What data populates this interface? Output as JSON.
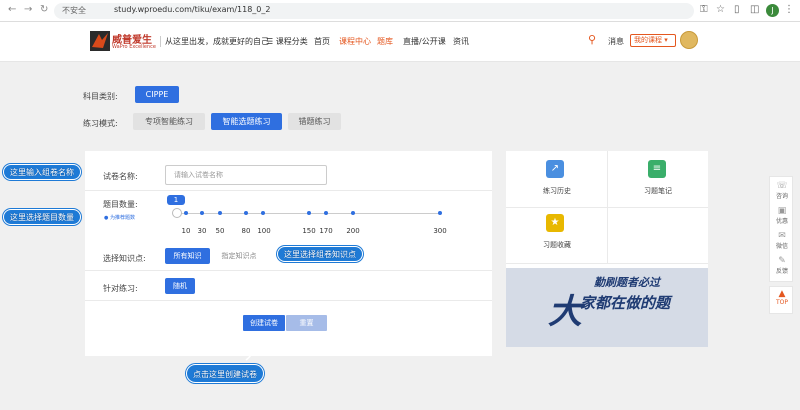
{
  "browser": {
    "security_label": "不安全",
    "url": "study.wproedu.com/tiku/exam/118_0_2",
    "profile_initial": "J"
  },
  "header": {
    "logo_cn": "威普爱生",
    "logo_en": "WaPro Excellence",
    "slogan": "从这里出发，成就更好的自己",
    "menu": [
      "课程分类",
      "首页",
      "课程中心",
      "题库",
      "直播/公开课",
      "资讯"
    ],
    "active_menu": "课程中心",
    "messages": "消息",
    "my_courses": "我的课程"
  },
  "filters": {
    "subject_label": "科目类别:",
    "subject_value": "CIPPE",
    "mode_label": "练习模式:",
    "modes": [
      "专项智能练习",
      "智能选题练习",
      "错题练习"
    ],
    "active_mode": "智能选题练习"
  },
  "form": {
    "paper_name_label": "试卷名称:",
    "paper_name_placeholder": "请输入试卷名称",
    "count_label": "题目数量:",
    "count_value": "1",
    "recommend_text": "为推荐题数",
    "ticks": [
      "10",
      "30",
      "50",
      "80",
      "100",
      "150",
      "170",
      "200",
      "300"
    ],
    "knowledge_label": "选择知识点:",
    "knowledge_all": "所有知识",
    "knowledge_specific": "指定知识点",
    "target_label": "针对练习:",
    "target_value": "随机",
    "create_button": "创建试卷",
    "reset_button": "重置"
  },
  "right_panel": {
    "items": [
      {
        "label": "练习历史",
        "color": "#4a8fe0"
      },
      {
        "label": "习题笔记",
        "color": "#3aae6a"
      },
      {
        "label": "习题收藏",
        "color": "#e8b800"
      }
    ],
    "banner_line1": "勤刷题者必过",
    "banner_line2": "家都在做的题",
    "banner_big": "大"
  },
  "side_toolbar": {
    "items": [
      "咨询",
      "优惠",
      "微信",
      "反馈"
    ],
    "top": "TOP"
  },
  "annotations": {
    "name": "这里输入组卷名称",
    "count": "这里选择题目数量",
    "knowledge": "这里选择组卷知识点",
    "create": "点击这里创建试卷"
  }
}
